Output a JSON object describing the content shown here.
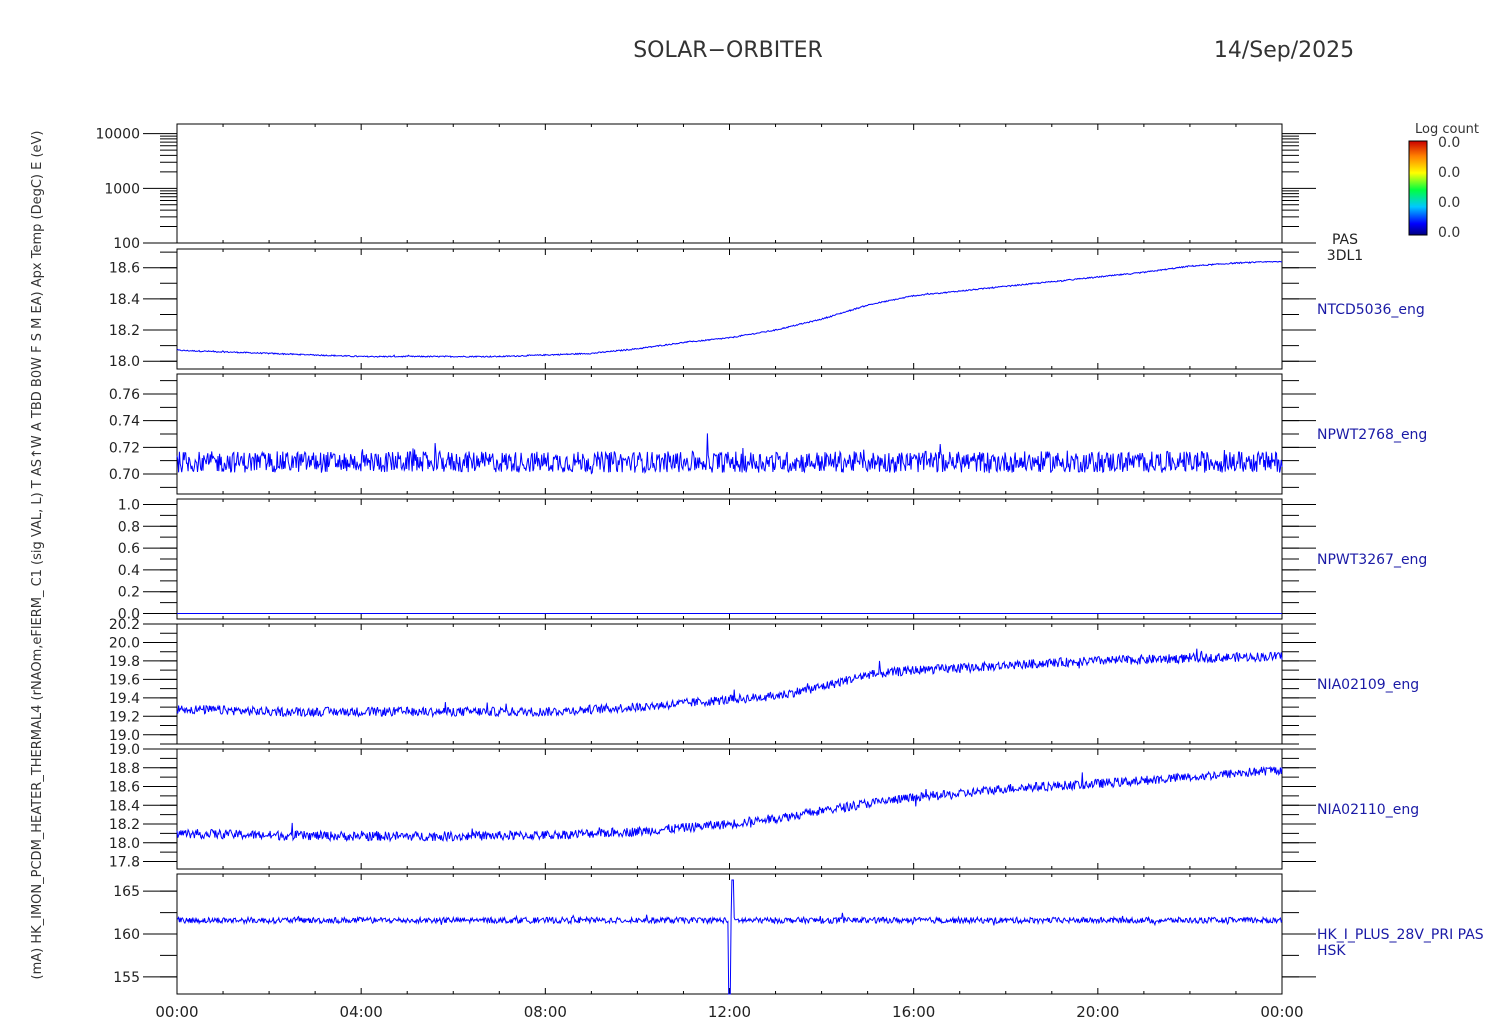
{
  "header": {
    "mission": "SOLAR−ORBITER",
    "date": "14/Sep/2025"
  },
  "colorbar": {
    "title": "Log count",
    "ticks": [
      "0.0",
      "0.0",
      "0.0",
      "0.0"
    ]
  },
  "rotated_axis_label": "(mA) HK_IMON_PCDM_HEATER_THERMAL4 (rNAOm,eFlERM_ C1 (sig VAL, L) T AS↑W A TBD B0W F S M EA) Apx Temp (DegC) E (eV)",
  "colors": {
    "trace": "#0000ff",
    "label": "#1a1aa6",
    "axis": "#000000"
  },
  "chart_data": [
    {
      "type": "heatmap",
      "id": "pas-energy",
      "scale": "log",
      "ylim": [
        100,
        15000
      ],
      "yticks": [
        100,
        1000,
        10000
      ],
      "ytick_labels": [
        "100",
        "1000",
        "10000"
      ],
      "label_lines": [
        "PAS",
        "3DL1"
      ],
      "values": []
    },
    {
      "type": "line",
      "id": "ntcd5036",
      "name": "NTCD5036_eng",
      "ylim": [
        17.95,
        18.72
      ],
      "yticks": [
        18.0,
        18.2,
        18.4,
        18.6
      ],
      "ytick_labels": [
        "18.0",
        "18.2",
        "18.4",
        "18.6"
      ],
      "x_hours": [
        0,
        1,
        2,
        3,
        4,
        5,
        6,
        7,
        8,
        9,
        10,
        11,
        12,
        13,
        14,
        15,
        16,
        17,
        18,
        19,
        20,
        21,
        22,
        23,
        24
      ],
      "values": [
        18.07,
        18.06,
        18.05,
        18.04,
        18.03,
        18.03,
        18.03,
        18.03,
        18.04,
        18.05,
        18.08,
        18.12,
        18.15,
        18.2,
        18.27,
        18.36,
        18.42,
        18.45,
        18.48,
        18.51,
        18.54,
        18.57,
        18.61,
        18.63,
        18.64
      ],
      "noise": 0.004
    },
    {
      "type": "line",
      "id": "npwt2768",
      "name": "NPWT2768_eng",
      "ylim": [
        0.685,
        0.775
      ],
      "yticks": [
        0.7,
        0.72,
        0.74,
        0.76
      ],
      "ytick_labels": [
        "0.70",
        "0.72",
        "0.74",
        "0.76"
      ],
      "x_hours": [
        0,
        24
      ],
      "values": [
        0.709,
        0.709
      ],
      "noise": 0.008
    },
    {
      "type": "line",
      "id": "npwt3267",
      "name": "NPWT3267_eng",
      "ylim": [
        -0.05,
        1.05
      ],
      "yticks": [
        0.0,
        0.2,
        0.4,
        0.6,
        0.8,
        1.0
      ],
      "ytick_labels": [
        "0.0",
        "0.2",
        "0.4",
        "0.6",
        "0.8",
        "1.0"
      ],
      "x_hours": [
        0,
        24
      ],
      "values": [
        0.0,
        0.0
      ],
      "noise": 0.0
    },
    {
      "type": "line",
      "id": "nia02109",
      "name": "NIA02109_eng",
      "ylim": [
        18.9,
        20.2
      ],
      "yticks": [
        19.0,
        19.2,
        19.4,
        19.6,
        19.8,
        20.0,
        20.2
      ],
      "ytick_labels": [
        "19.0",
        "19.2",
        "19.4",
        "19.6",
        "19.8",
        "20.0",
        "20.2"
      ],
      "x_hours": [
        0,
        2,
        4,
        6,
        8,
        10,
        12,
        13,
        14,
        15,
        16,
        17,
        18,
        19,
        20,
        22,
        24
      ],
      "values": [
        19.28,
        19.25,
        19.25,
        19.25,
        19.25,
        19.3,
        19.38,
        19.42,
        19.52,
        19.65,
        19.7,
        19.72,
        19.75,
        19.78,
        19.8,
        19.83,
        19.85
      ],
      "noise": 0.05
    },
    {
      "type": "line",
      "id": "nia02110",
      "name": "NIA02110_eng",
      "ylim": [
        17.72,
        19.0
      ],
      "yticks": [
        17.8,
        18.0,
        18.2,
        18.4,
        18.6,
        18.8,
        19.0
      ],
      "ytick_labels": [
        "17.8",
        "18.0",
        "18.2",
        "18.4",
        "18.6",
        "18.8",
        "19.0"
      ],
      "x_hours": [
        0,
        2,
        4,
        6,
        8,
        10,
        12,
        13,
        14,
        15,
        16,
        17,
        18,
        20,
        22,
        24
      ],
      "values": [
        18.1,
        18.08,
        18.07,
        18.07,
        18.08,
        18.12,
        18.2,
        18.26,
        18.34,
        18.42,
        18.48,
        18.52,
        18.58,
        18.63,
        18.7,
        18.78
      ],
      "noise": 0.05
    },
    {
      "type": "line",
      "id": "hk-i-plus-28v",
      "name": "HK_I_PLUS_28V_PRI PAS",
      "name_line2": "HSK",
      "ylim": [
        153,
        167
      ],
      "yticks": [
        155,
        160,
        165
      ],
      "ytick_labels": [
        "155",
        "160",
        "165"
      ],
      "x_hours": [
        0,
        24
      ],
      "values": [
        161.6,
        161.6
      ],
      "noise": 0.35,
      "spike": {
        "x_hour": 12.0,
        "min": 152.7,
        "max": 166.3
      }
    }
  ],
  "x_axis": {
    "xlim_hours": [
      0,
      24
    ],
    "tick_hours": [
      0,
      4,
      8,
      12,
      16,
      20,
      24
    ],
    "tick_labels": [
      "00:00",
      "04:00",
      "08:00",
      "12:00",
      "16:00",
      "20:00",
      "00:00"
    ],
    "minor_every_hours": 1
  }
}
